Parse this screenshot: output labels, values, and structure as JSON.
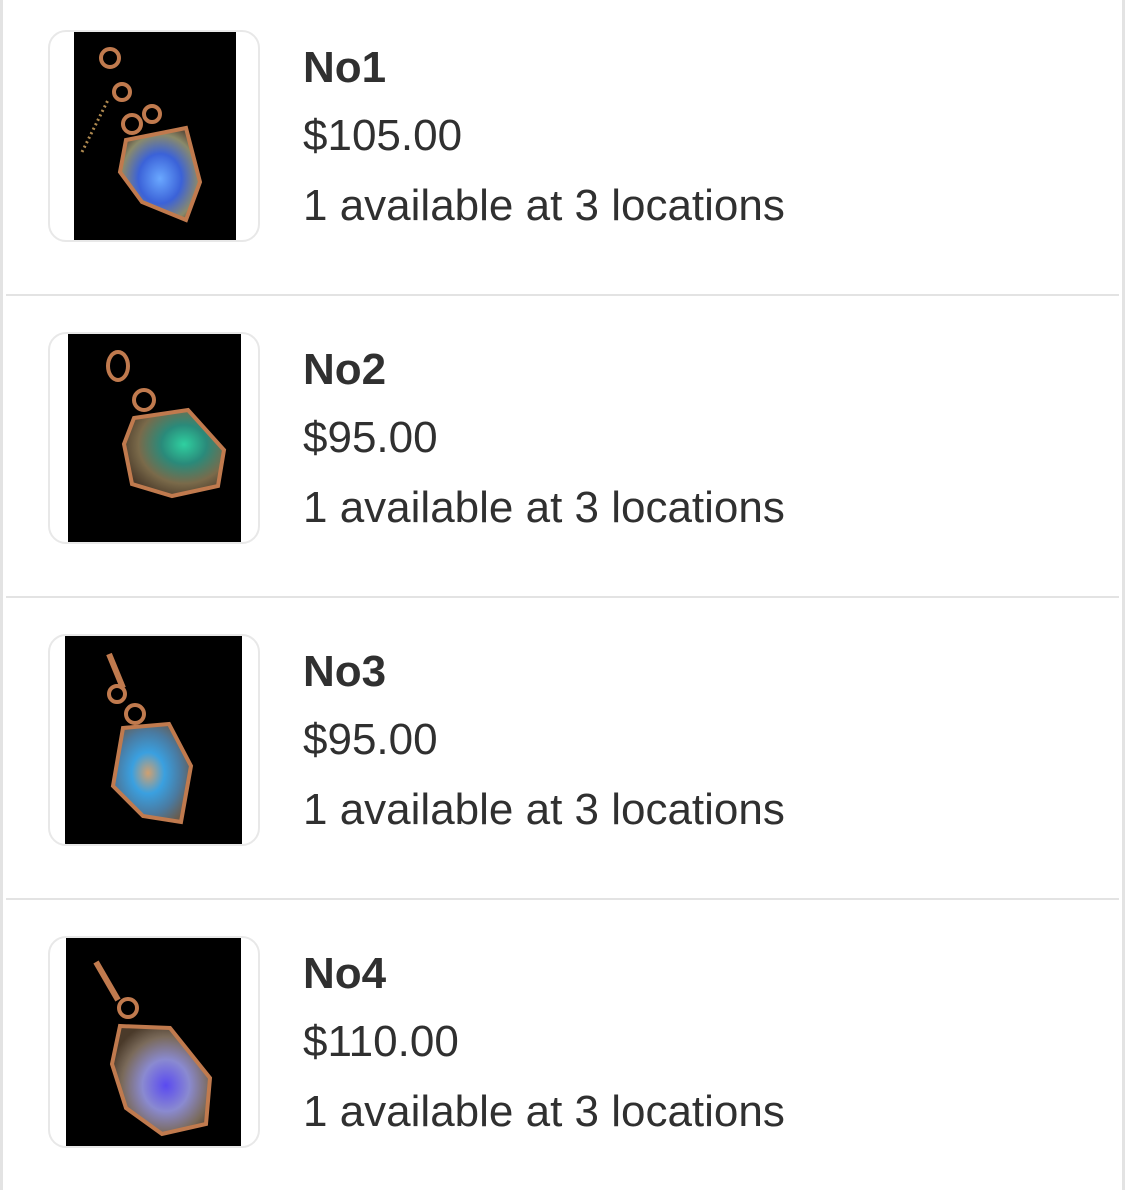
{
  "products": [
    {
      "title": "No1",
      "price": "$105.00",
      "availability": "1 available at 3 locations",
      "image_icon": "opal-pendant-image"
    },
    {
      "title": "No2",
      "price": "$95.00",
      "availability": "1 available at 3 locations",
      "image_icon": "opal-pendant-image"
    },
    {
      "title": "No3",
      "price": "$95.00",
      "availability": "1 available at 3 locations",
      "image_icon": "opal-pendant-image"
    },
    {
      "title": "No4",
      "price": "$110.00",
      "availability": "1 available at 3 locations",
      "image_icon": "opal-pendant-image"
    }
  ],
  "colors": {
    "text": "#303030",
    "divider": "#e3e3e3",
    "copper_wire": "#c07a4e",
    "photo_background": "#000000"
  }
}
